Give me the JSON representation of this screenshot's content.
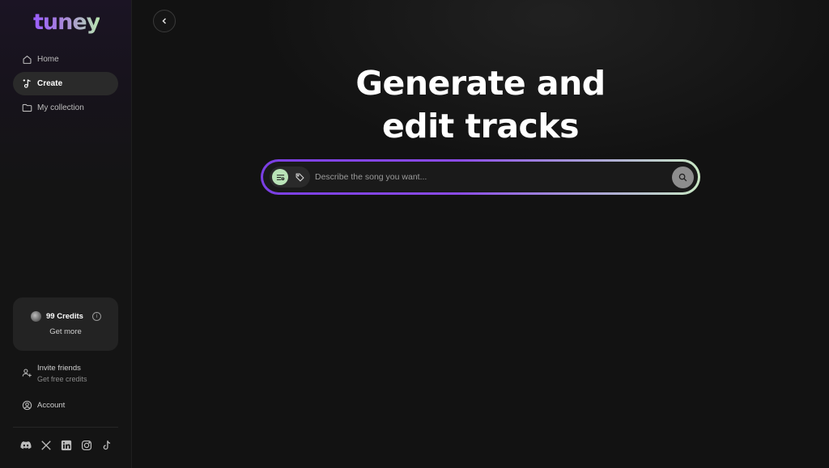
{
  "app": {
    "logo": "tuney"
  },
  "sidebar": {
    "items": [
      {
        "label": "Home",
        "icon": "home-icon",
        "active": false
      },
      {
        "label": "Create",
        "icon": "music-note-icon",
        "active": true
      },
      {
        "label": "My collection",
        "icon": "folder-icon",
        "active": false
      }
    ],
    "credits": {
      "label": "99 Credits",
      "action": "Get more"
    },
    "invite": {
      "title": "Invite friends",
      "subtitle": "Get free credits"
    },
    "account": {
      "label": "Account"
    },
    "socials": [
      "discord-icon",
      "x-icon",
      "linkedin-icon",
      "instagram-icon",
      "tiktok-icon"
    ]
  },
  "main": {
    "hero_line1": "Generate and",
    "hero_line2": "edit tracks",
    "prompt": {
      "placeholder": "Describe the song you want..."
    }
  },
  "colors": {
    "accent_purple": "#7b3fe4",
    "accent_green": "#b9e3b7",
    "background": "#121212"
  }
}
